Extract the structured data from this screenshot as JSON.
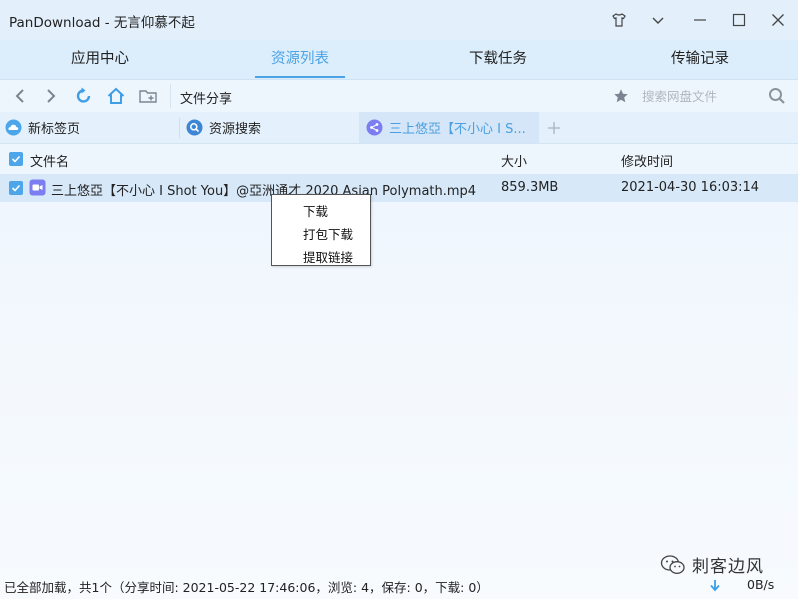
{
  "window": {
    "title": "PanDownload - 无言仰慕不起"
  },
  "nav_tabs": [
    {
      "label": "应用中心"
    },
    {
      "label": "资源列表"
    },
    {
      "label": "下载任务"
    },
    {
      "label": "传输记录"
    }
  ],
  "toolbar": {
    "path_label": "文件分享",
    "search_placeholder": "搜索网盘文件"
  },
  "tabs": [
    {
      "label": "新标签页"
    },
    {
      "label": "资源搜索"
    },
    {
      "label": "三上悠亞【不小心 I S..."
    }
  ],
  "table": {
    "headers": {
      "name": "文件名",
      "size": "大小",
      "modified": "修改时间"
    },
    "rows": [
      {
        "name": "三上悠亞【不小心 I Shot You】@亞洲通才 2020 Asian Polymath.mp4",
        "size": "859.3MB",
        "modified": "2021-04-30 16:03:14"
      }
    ]
  },
  "context_menu": {
    "items": [
      "下载",
      "打包下载",
      "提取链接"
    ]
  },
  "status": {
    "text": "已全部加载，共1个（分享时间: 2021-05-22 17:46:06，浏览: 4，保存: 0，下载: 0）",
    "speed": "0B/s"
  },
  "watermark": {
    "text": "刺客边风"
  },
  "colors": {
    "accent": "#4ba3e6",
    "selected_row": "#d7e9f9",
    "video_icon": "#7c7df0"
  }
}
